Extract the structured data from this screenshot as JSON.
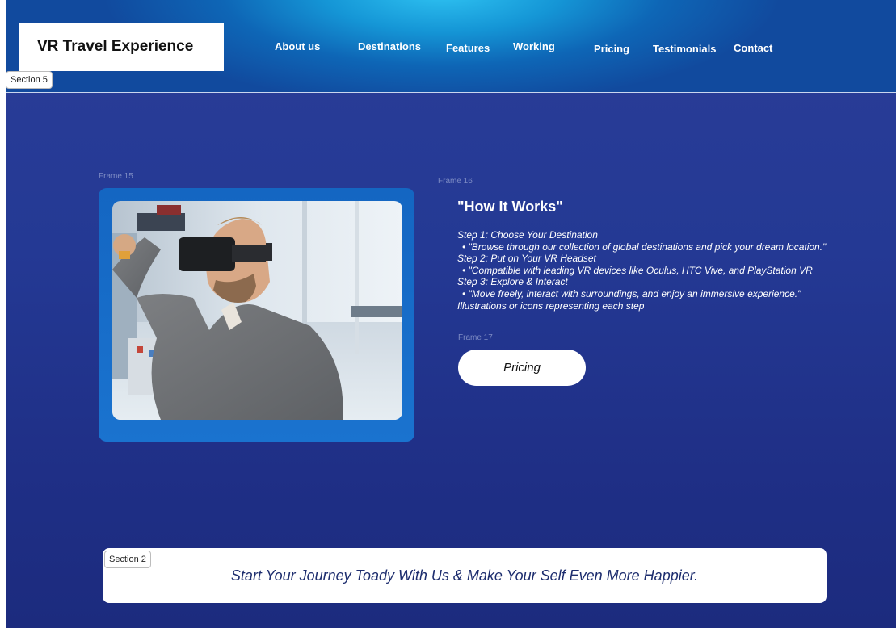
{
  "header": {
    "logo_text": "VR Travel Experience",
    "nav": [
      {
        "label": "About us"
      },
      {
        "label": "Destinations"
      },
      {
        "label": "Features"
      },
      {
        "label": "Working"
      },
      {
        "label": "Pricing"
      },
      {
        "label": "Testimonials"
      },
      {
        "label": "Contact"
      }
    ]
  },
  "tags": {
    "section5": "Section 5",
    "section2": "Section 2"
  },
  "frames": {
    "frame15": "Frame 15",
    "frame16": "Frame 16",
    "frame17": "Frame 17"
  },
  "how_it_works": {
    "title": "\"How It Works\"",
    "step1_title": "Step 1: Choose Your Destination",
    "step1_text": "\"Browse through our collection of global destinations and pick your dream location.\"",
    "step2_title": "Step 2: Put on Your VR Headset",
    "step2_text": "\"Compatible with leading VR devices like Oculus, HTC Vive, and PlayStation VR",
    "step3_title": "Step 3: Explore & Interact",
    "step3_text": "\"Move freely, interact with surroundings, and enjoy an immersive experience.\"",
    "note": "Illustrations or icons representing each step",
    "pricing_button": "Pricing"
  },
  "cta": {
    "text": "Start Your Journey Toady With Us & Make Your Self Even More Happier."
  },
  "colors": {
    "background": "#243994",
    "header_glow": "#2fc3f2",
    "frame_blue": "#1466c2",
    "cta_text": "#1d2d6e"
  }
}
